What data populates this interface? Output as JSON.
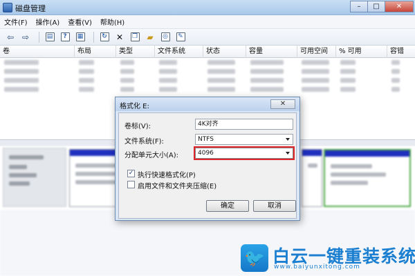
{
  "app": {
    "title": "磁盘管理"
  },
  "window_controls": {
    "minimize": "–",
    "maximize": "□",
    "close": "✕"
  },
  "menu": [
    "文件(F)",
    "操作(A)",
    "查看(V)",
    "帮助(H)"
  ],
  "columns": [
    "卷",
    "布局",
    "类型",
    "文件系统",
    "状态",
    "容量",
    "可用空间",
    "% 可用",
    "容错"
  ],
  "dialog": {
    "title": "格式化 E:",
    "close_label": "✕",
    "volume_label_text": "卷标(V):",
    "volume_label_value": "4K对齐",
    "filesystem_text": "文件系统(F):",
    "filesystem_value": "NTFS",
    "alloc_text": "分配单元大小(A):",
    "alloc_value": "4096",
    "quick_format_text": "执行快速格式化(P)",
    "quick_format_checked": true,
    "quick_format_mark": "✓",
    "compress_text": "启用文件和文件夹压缩(E)",
    "compress_checked": false,
    "ok_label": "确定",
    "cancel_label": "取消"
  },
  "watermark": {
    "brand": "白云一键重装系统",
    "url": "www.baiyunxitong.com",
    "logo_glyph": "🐦",
    "color": "#1b7fd1"
  },
  "colors": {
    "highlight_box": "#e0242a",
    "partition_bar": "#1f2fbf",
    "selected_partition": "#4aa744"
  }
}
